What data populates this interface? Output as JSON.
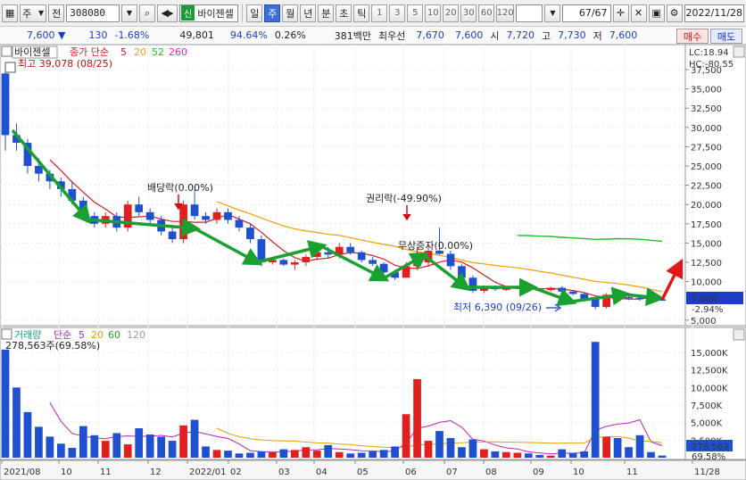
{
  "toolbar": {
    "market_label": "주",
    "prev_label": "전",
    "code": "308080",
    "badge": "신",
    "stock_name": "바이젠셀",
    "periods": [
      "일",
      "주",
      "월",
      "년",
      "분",
      "초",
      "틱"
    ],
    "active_period": "주",
    "intervals": [
      "1",
      "3",
      "5",
      "10",
      "20",
      "30",
      "60",
      "120"
    ],
    "counter": "67/67",
    "date": "2022/11/28"
  },
  "quote": {
    "price": "7,600",
    "arrow": "▼",
    "change": "130",
    "change_pct": "-1.68%",
    "volume": "49,801",
    "vol_ratio": "94.64%",
    "rate2": "0.26%",
    "trade_value": "381백만",
    "best_label": "최우선",
    "best_sell": "7,670",
    "best_buy": "7,600",
    "open_label": "시",
    "open": "7,720",
    "high_label": "고",
    "high": "7,730",
    "low_label": "저",
    "low": "7,600",
    "buy_label": "매수",
    "sell_label": "매도"
  },
  "price_panel": {
    "title": "바이젠셀",
    "legend_label": "종가 단순",
    "ma_periods": [
      "5",
      "20",
      "52",
      "260"
    ],
    "ma_colors": [
      "#d02020",
      "#f0a000",
      "#20c020",
      "#e020e0"
    ],
    "high_label": "최고 39,078 (08/25)",
    "low_label": "최저 6,390 (09/26)",
    "lc": "LC:18.94",
    "hc": "HC:-80.55",
    "current_price": "7,600",
    "current_pct": "-2.94%",
    "events": [
      "배당락(0.00%)",
      "권리락(-49.90%)",
      "무상증자(0.00%)"
    ]
  },
  "volume_panel": {
    "title": "거래량",
    "legend_label": "단순",
    "ma_periods": [
      "5",
      "20",
      "60",
      "120"
    ],
    "ma_colors": [
      "#c020c0",
      "#e0a000",
      "#20a020",
      "#999999"
    ],
    "current_label": "278,563주(69.58%)",
    "current_value": "278,563",
    "current_pct": "69.58%"
  },
  "colors": {
    "up": "#e02020",
    "down": "#1e50d0",
    "arrow_green": "#1aa030",
    "arrow_red": "#e01818"
  },
  "chart_data": {
    "type": "candlestick",
    "period": "weekly",
    "price_axis_ticks": [
      "37,500",
      "35,000",
      "32,500",
      "30,000",
      "27,500",
      "25,000",
      "22,500",
      "20,000",
      "17,500",
      "15,000",
      "12,500",
      "10,000",
      "5,000"
    ],
    "volume_axis_ticks": [
      "15,000K",
      "12,500K",
      "10,000K",
      "7,500K",
      "5,000K",
      "2,500K"
    ],
    "x_ticks": [
      "2021/08",
      "10",
      "11",
      "12",
      "2022/01",
      "02",
      "03",
      "04",
      "05",
      "06",
      "07",
      "08",
      "09",
      "10",
      "11",
      "11/28"
    ],
    "candles": [
      [
        37000,
        37500,
        27000,
        29000
      ],
      [
        29000,
        30500,
        27000,
        28000
      ],
      [
        28000,
        28500,
        24000,
        25000
      ],
      [
        25000,
        26000,
        23000,
        24000
      ],
      [
        24000,
        24500,
        22000,
        23000
      ],
      [
        23000,
        23500,
        21000,
        22000
      ],
      [
        22000,
        23000,
        20000,
        20500
      ],
      [
        20500,
        21000,
        18000,
        18500
      ],
      [
        18500,
        19000,
        17000,
        17500
      ],
      [
        17500,
        19000,
        17000,
        18500
      ],
      [
        18500,
        19000,
        16500,
        17000
      ],
      [
        17000,
        20500,
        16500,
        20000
      ],
      [
        20000,
        21000,
        18500,
        19000
      ],
      [
        19000,
        19500,
        17500,
        18000
      ],
      [
        18000,
        18500,
        16000,
        16500
      ],
      [
        16500,
        17000,
        15000,
        15500
      ],
      [
        15500,
        20500,
        15000,
        20000
      ],
      [
        20000,
        22000,
        18000,
        18500
      ],
      [
        18500,
        19000,
        17500,
        18000
      ],
      [
        18000,
        19500,
        17500,
        19000
      ],
      [
        19000,
        19500,
        17500,
        18000
      ],
      [
        18000,
        18500,
        16500,
        17000
      ],
      [
        17000,
        17500,
        15000,
        15500
      ],
      [
        15500,
        16000,
        12000,
        12500
      ],
      [
        12500,
        13000,
        12200,
        12800
      ],
      [
        12800,
        13000,
        12000,
        12200
      ],
      [
        12200,
        12800,
        11500,
        12500
      ],
      [
        12500,
        13500,
        12000,
        13200
      ],
      [
        13200,
        14000,
        12800,
        13800
      ],
      [
        13800,
        14500,
        13000,
        13500
      ],
      [
        13500,
        15000,
        13000,
        14500
      ],
      [
        14500,
        15000,
        13500,
        13800
      ],
      [
        13800,
        14000,
        12500,
        12800
      ],
      [
        12800,
        13200,
        12000,
        12300
      ],
      [
        12300,
        12500,
        11000,
        11200
      ],
      [
        11200,
        11500,
        10200,
        10500
      ],
      [
        10500,
        12500,
        10500,
        12000
      ],
      [
        12000,
        14500,
        11500,
        12500
      ],
      [
        12500,
        14800,
        12000,
        14000
      ],
      [
        14000,
        17000,
        13500,
        13600
      ],
      [
        13600,
        14000,
        11500,
        12000
      ],
      [
        12000,
        12200,
        10000,
        10500
      ],
      [
        10500,
        10800,
        8500,
        8800
      ],
      [
        8800,
        9500,
        8500,
        9300
      ],
      [
        9300,
        9500,
        8800,
        9000
      ],
      [
        9000,
        9300,
        8800,
        9100
      ],
      [
        9100,
        9500,
        9000,
        9300
      ],
      [
        9300,
        9600,
        8900,
        9000
      ],
      [
        9000,
        9200,
        8700,
        8900
      ],
      [
        8900,
        9300,
        8700,
        9200
      ],
      [
        9200,
        9400,
        8600,
        8700
      ],
      [
        8700,
        8900,
        8200,
        8400
      ],
      [
        8400,
        8600,
        7500,
        7700
      ],
      [
        7700,
        8000,
        6390,
        6700
      ],
      [
        6700,
        8500,
        6500,
        8300
      ],
      [
        8300,
        8600,
        7800,
        8000
      ],
      [
        8000,
        8300,
        7600,
        7900
      ],
      [
        7900,
        8200,
        7500,
        7800
      ],
      [
        7800,
        8100,
        7500,
        7700
      ],
      [
        7700,
        7800,
        7500,
        7600
      ]
    ],
    "volumes_k": [
      15400,
      10000,
      6500,
      4400,
      3000,
      2000,
      1400,
      4500,
      3200,
      2400,
      3500,
      1900,
      4200,
      3300,
      3000,
      2400,
      4600,
      5400,
      1600,
      1100,
      1000,
      600,
      700,
      900,
      800,
      1200,
      1100,
      1500,
      1000,
      1800,
      800,
      600,
      700,
      900,
      1100,
      1600,
      6200,
      11200,
      2400,
      3800,
      2800,
      1500,
      2600,
      1200,
      900,
      800,
      700,
      600,
      400,
      300,
      1200,
      700,
      900,
      16500,
      3000,
      2800,
      1500,
      3200,
      800,
      300
    ]
  }
}
